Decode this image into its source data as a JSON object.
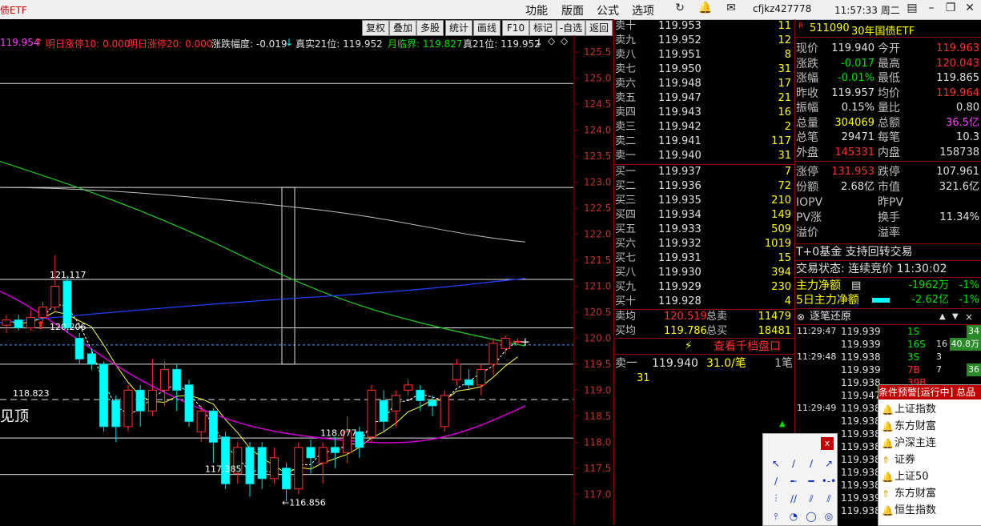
{
  "window": {
    "title": "债ETF",
    "menus": [
      "功能",
      "版面",
      "公式",
      "选项"
    ],
    "user": "cfjkz427778",
    "clock": "11:57:33 周二"
  },
  "toolbar": [
    "复权",
    "叠加",
    "多股",
    "统计",
    "画线",
    "F10",
    "标记",
    "-自选",
    "返回"
  ],
  "indicator_bar": {
    "v0": "119.954",
    "t1": "明日涨停10: 0.000",
    "t2": "明日涨停20: 0.000",
    "t3": "涨跌幅度: -0.019",
    "t4": "真实21位: 119.952",
    "t5": "月临界: 119.827",
    "t6": "真21位: 119.952"
  },
  "chart_data": {
    "type": "candlestick",
    "y_ticks": [
      "125.5",
      "125.0",
      "124.5",
      "124.0",
      "123.5",
      "123.0",
      "122.5",
      "122.0",
      "121.5",
      "121.0",
      "120.5",
      "120.0",
      "119.5",
      "119.0",
      "118.5",
      "118.0",
      "117.5",
      "117.0"
    ],
    "ylim": [
      116.85,
      125.55
    ],
    "annotations": [
      "121.117",
      "120.206",
      "118.823",
      "118.077",
      "117.385",
      "←116.856"
    ],
    "side_text": "见顶",
    "hlines": [
      124.9,
      122.9,
      121.13,
      120.2,
      119.87,
      119.5,
      118.82,
      118.08,
      117.38
    ],
    "candles": [
      {
        "o": 120.25,
        "c": 120.35,
        "h": 120.45,
        "l": 120.1
      },
      {
        "o": 120.35,
        "c": 120.2,
        "h": 120.45,
        "l": 120.15
      },
      {
        "o": 120.2,
        "c": 120.4,
        "h": 120.55,
        "l": 120.15
      },
      {
        "o": 120.4,
        "c": 120.6,
        "h": 120.7,
        "l": 120.3
      },
      {
        "o": 120.6,
        "c": 121.0,
        "h": 121.6,
        "l": 120.5
      },
      {
        "o": 121.1,
        "c": 120.2,
        "h": 121.2,
        "l": 120.1
      },
      {
        "o": 120.0,
        "c": 119.6,
        "h": 120.1,
        "l": 119.5
      },
      {
        "o": 119.7,
        "c": 119.5,
        "h": 119.8,
        "l": 119.4
      },
      {
        "o": 119.5,
        "c": 118.3,
        "h": 119.55,
        "l": 118.2
      },
      {
        "o": 118.8,
        "c": 118.3,
        "h": 118.9,
        "l": 118.0
      },
      {
        "o": 118.3,
        "c": 119.0,
        "h": 119.1,
        "l": 118.2
      },
      {
        "o": 119.0,
        "c": 118.6,
        "h": 119.1,
        "l": 118.3
      },
      {
        "o": 118.6,
        "c": 119.0,
        "h": 119.6,
        "l": 118.5
      },
      {
        "o": 119.0,
        "c": 119.4,
        "h": 119.55,
        "l": 118.7
      },
      {
        "o": 119.4,
        "c": 119.0,
        "h": 119.5,
        "l": 118.6
      },
      {
        "o": 119.1,
        "c": 118.4,
        "h": 119.2,
        "l": 118.3
      },
      {
        "o": 118.2,
        "c": 118.6,
        "h": 118.7,
        "l": 118.0
      },
      {
        "o": 118.6,
        "c": 118.0,
        "h": 118.65,
        "l": 117.6
      },
      {
        "o": 118.1,
        "c": 117.2,
        "h": 118.2,
        "l": 117.1
      },
      {
        "o": 117.4,
        "c": 117.9,
        "h": 118.0,
        "l": 117.2
      },
      {
        "o": 117.9,
        "c": 117.2,
        "h": 118.0,
        "l": 116.95
      },
      {
        "o": 117.9,
        "c": 117.3,
        "h": 118.0,
        "l": 117.1
      },
      {
        "o": 117.3,
        "c": 117.7,
        "h": 117.9,
        "l": 117.2
      },
      {
        "o": 117.5,
        "c": 117.1,
        "h": 117.6,
        "l": 116.86
      },
      {
        "o": 117.1,
        "c": 117.9,
        "h": 118.0,
        "l": 117.0
      },
      {
        "o": 117.9,
        "c": 117.7,
        "h": 118.05,
        "l": 117.4
      },
      {
        "o": 117.6,
        "c": 117.9,
        "h": 118.0,
        "l": 117.2
      },
      {
        "o": 117.9,
        "c": 117.8,
        "h": 118.1,
        "l": 117.5
      },
      {
        "o": 117.8,
        "c": 118.2,
        "h": 118.5,
        "l": 117.6
      },
      {
        "o": 118.2,
        "c": 117.9,
        "h": 118.3,
        "l": 117.7
      },
      {
        "o": 118.1,
        "c": 119.0,
        "h": 119.1,
        "l": 118.0
      },
      {
        "o": 118.8,
        "c": 118.4,
        "h": 119.0,
        "l": 118.2
      },
      {
        "o": 118.6,
        "c": 118.9,
        "h": 119.0,
        "l": 118.3
      },
      {
        "o": 119.0,
        "c": 119.1,
        "h": 119.2,
        "l": 118.9
      },
      {
        "o": 119.0,
        "c": 118.8,
        "h": 119.1,
        "l": 118.6
      },
      {
        "o": 118.8,
        "c": 118.7,
        "h": 118.9,
        "l": 118.5
      },
      {
        "o": 118.3,
        "c": 118.9,
        "h": 119.0,
        "l": 118.2
      },
      {
        "o": 119.2,
        "c": 119.5,
        "h": 119.6,
        "l": 119.1
      },
      {
        "o": 119.2,
        "c": 119.1,
        "h": 119.4,
        "l": 119.0
      },
      {
        "o": 119.1,
        "c": 119.4,
        "h": 119.5,
        "l": 118.9
      },
      {
        "o": 119.5,
        "c": 119.9,
        "h": 120.0,
        "l": 119.3
      },
      {
        "o": 119.8,
        "c": 120.0,
        "h": 120.05,
        "l": 119.7
      },
      {
        "o": 119.94,
        "c": 119.94,
        "h": 120.0,
        "l": 119.9
      }
    ]
  },
  "quote": {
    "code": "511090",
    "name": "30年国债ETF",
    "asks": [
      {
        "label": "卖十",
        "price": "119.953",
        "vol": "11"
      },
      {
        "label": "卖九",
        "price": "119.952",
        "vol": "12"
      },
      {
        "label": "卖八",
        "price": "119.951",
        "vol": "8"
      },
      {
        "label": "卖七",
        "price": "119.950",
        "vol": "31"
      },
      {
        "label": "卖六",
        "price": "119.948",
        "vol": "17"
      },
      {
        "label": "卖五",
        "price": "119.947",
        "vol": "21"
      },
      {
        "label": "卖四",
        "price": "119.943",
        "vol": "16"
      },
      {
        "label": "卖三",
        "price": "119.942",
        "vol": "2"
      },
      {
        "label": "卖二",
        "price": "119.941",
        "vol": "117"
      },
      {
        "label": "卖一",
        "price": "119.940",
        "vol": "31"
      }
    ],
    "bids": [
      {
        "label": "买一",
        "price": "119.937",
        "vol": "7"
      },
      {
        "label": "买二",
        "price": "119.936",
        "vol": "72"
      },
      {
        "label": "买三",
        "price": "119.935",
        "vol": "210"
      },
      {
        "label": "买四",
        "price": "119.934",
        "vol": "149"
      },
      {
        "label": "买五",
        "price": "119.933",
        "vol": "509"
      },
      {
        "label": "买六",
        "price": "119.932",
        "vol": "1019"
      },
      {
        "label": "买七",
        "price": "119.931",
        "vol": "15"
      },
      {
        "label": "买八",
        "price": "119.930",
        "vol": "394"
      },
      {
        "label": "买九",
        "price": "119.929",
        "vol": "230"
      },
      {
        "label": "买十",
        "price": "119.928",
        "vol": "4"
      }
    ],
    "avg_sell": {
      "label": "卖均",
      "price": "120.519",
      "tlabel": "总卖",
      "vol": "11479"
    },
    "avg_buy": {
      "label": "买均",
      "price": "119.786",
      "tlabel": "总买",
      "vol": "18481"
    },
    "view_depth": "查看千档盘口",
    "ask1_line": {
      "label": "卖一",
      "price": "119.940",
      "qty": "31.0/笔",
      "n": "1笔",
      "sub": "31"
    },
    "stats": [
      {
        "l1": "现价",
        "v1": "119.940",
        "l2": "今开",
        "v2": "119.963"
      },
      {
        "l1": "涨跌",
        "v1": "-0.017",
        "l2": "最高",
        "v2": "120.043"
      },
      {
        "l1": "涨幅",
        "v1": "-0.01%",
        "l2": "最低",
        "v2": "119.865"
      },
      {
        "l1": "昨收",
        "v1": "119.957",
        "l2": "均价",
        "v2": "119.964"
      },
      {
        "l1": "振幅",
        "v1": "0.15%",
        "l2": "量比",
        "v2": "0.80"
      },
      {
        "l1": "总量",
        "v1": "304069",
        "l2": "总额",
        "v2": "36.5亿"
      },
      {
        "l1": "总笔",
        "v1": "29471",
        "l2": "每笔",
        "v2": "10.3"
      },
      {
        "l1": "外盘",
        "v1": "145331",
        "l2": "内盘",
        "v2": "158738"
      }
    ],
    "stats2": [
      {
        "l1": "涨停",
        "v1": "131.953",
        "l2": "跌停",
        "v2": "107.961"
      },
      {
        "l1": "份额",
        "v1": "2.68亿",
        "l2": "市值",
        "v2": "321.6亿"
      },
      {
        "l1": "IOPV",
        "v1": "",
        "l2": "昨PV",
        "v2": ""
      },
      {
        "l1": "PV涨",
        "v1": "",
        "l2": "换手",
        "v2": "11.34%"
      },
      {
        "l1": "溢价",
        "v1": "",
        "l2": "溢率",
        "v2": ""
      }
    ],
    "t0": "T+0基金 支持回转交易",
    "trade_state": "交易状态: 连续竞价 11:30:02",
    "main_net": {
      "label": "主力净额",
      "value": "-1962万",
      "pct": "-1%"
    },
    "main_net5": {
      "label": "5日主力净额",
      "value": "-2.62亿",
      "pct": "-1%"
    },
    "tick_title": "逐笔还原"
  },
  "ticks": [
    {
      "t": "11:29:47",
      "p": "119.939",
      "a": "1S",
      "b": "",
      "c": "34"
    },
    {
      "t": "",
      "p": "119.939",
      "a": "16S",
      "b": "16",
      "c": "40.8万"
    },
    {
      "t": "11:29:48",
      "p": "119.938",
      "a": "3S",
      "b": "3",
      "c": ""
    },
    {
      "t": "",
      "p": "119.939",
      "a": "7B",
      "b": "7",
      "c": "36"
    },
    {
      "t": "",
      "p": "119.938",
      "a": "39B",
      "b": "",
      "c": ""
    },
    {
      "t": "",
      "p": "119.947",
      "a": "",
      "b": "",
      "c": ""
    },
    {
      "t": "11:29:49",
      "p": "119.938",
      "a": "",
      "b": "",
      "c": ""
    },
    {
      "t": "",
      "p": "119.938",
      "a": "",
      "b": "",
      "c": ""
    },
    {
      "t": "",
      "p": "119.938",
      "a": "",
      "b": "",
      "c": ""
    },
    {
      "t": "",
      "p": "119.938",
      "a": "",
      "b": "",
      "c": ""
    },
    {
      "t": "",
      "p": "119.938",
      "a": "",
      "b": "",
      "c": ""
    },
    {
      "t": "",
      "p": "119.938",
      "a": "",
      "b": "",
      "c": ""
    },
    {
      "t": "",
      "p": "119.938",
      "a": "",
      "b": "",
      "c": ""
    },
    {
      "t": "",
      "p": "119.939",
      "a": "",
      "b": "",
      "c": ""
    },
    {
      "t": "",
      "p": "119.938",
      "a": "",
      "b": "",
      "c": ""
    }
  ],
  "alert": {
    "header": "条件预警[运行中] 总品种",
    "items": [
      "上证指数",
      "东方财富",
      "沪深主连",
      "证券",
      "上证50",
      "东方财富",
      "恒生指数"
    ]
  },
  "palette": {
    "close": "x"
  }
}
